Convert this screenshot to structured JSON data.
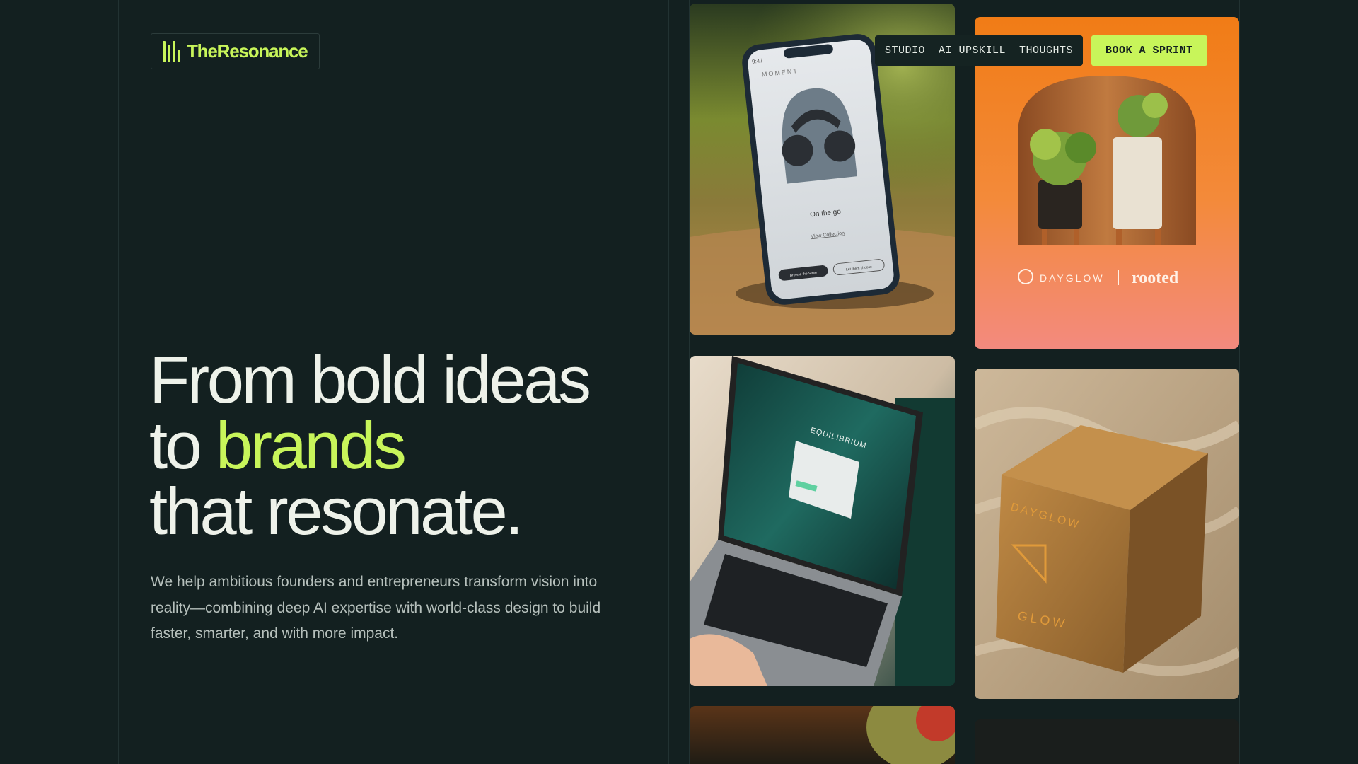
{
  "brand": {
    "name": "TheResonance",
    "accent_color": "#c8f55a",
    "background_color": "#132020"
  },
  "nav": {
    "links": [
      {
        "label": "STUDIO"
      },
      {
        "label": "AI UPSKILL"
      },
      {
        "label": "THOUGHTS"
      }
    ],
    "cta_label": "BOOK A SPRINT"
  },
  "hero": {
    "title_line1": "From bold ideas",
    "title_line2_prefix": "to ",
    "title_line2_accent": "brands",
    "title_line3": "that resonate.",
    "subtitle": "We help ambitious founders and entrepreneurs transform vision into reality—combining deep AI expertise with world-class design to build faster, smarter, and with more impact."
  },
  "gallery": {
    "phone": {
      "app_name": "MOMENT",
      "time": "9:47",
      "caption": "On the go",
      "link": "View Collection",
      "btn_primary": "Browse the Store",
      "btn_secondary": "Let them choose"
    },
    "dayglow": {
      "brand_left": "DAYGLOW",
      "brand_right": "rooted"
    },
    "laptop": {
      "screen_title": "EQUILIBRIUM"
    },
    "box": {
      "print_top": "DAYGLOW",
      "print_bottom": "GLOW"
    }
  }
}
